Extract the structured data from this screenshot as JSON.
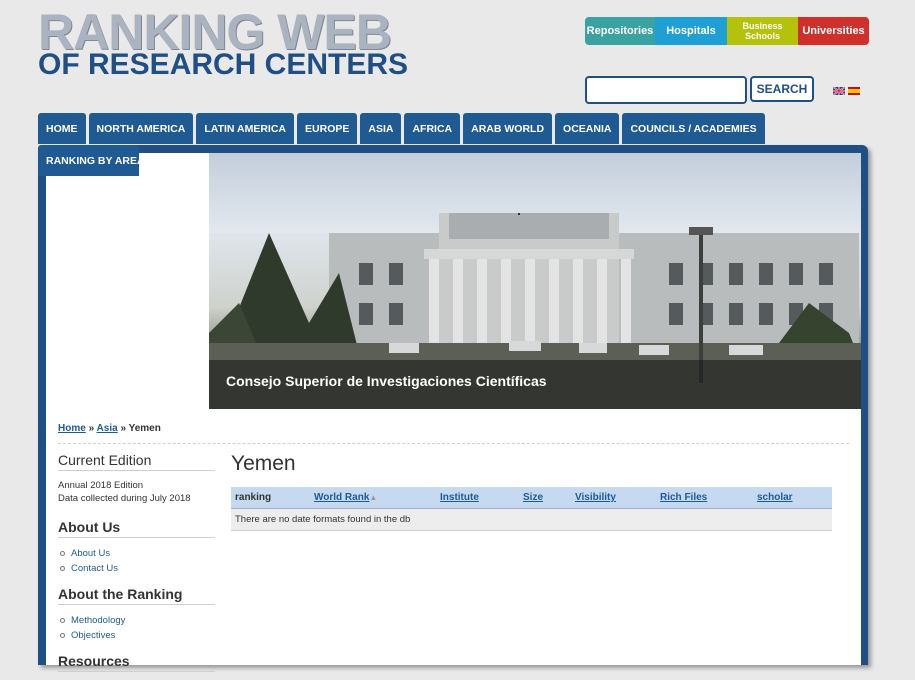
{
  "logo": {
    "line1": "RANKING WEB",
    "line2": "OF RESEARCH CENTERS"
  },
  "toplinks": {
    "repositories": "Repositories",
    "hospitals": "Hospitals",
    "business_line1": "Business",
    "business_line2": "Schools",
    "universities": "Universities"
  },
  "search": {
    "button": "SEARCH",
    "placeholder": ""
  },
  "nav": {
    "items": [
      "HOME",
      "NORTH AMERICA",
      "LATIN AMERICA",
      "EUROPE",
      "ASIA",
      "AFRICA",
      "ARAB WORLD",
      "OCEANIA",
      "COUNCILS / ACADEMIES"
    ],
    "second_row": "RANKING BY AREAS"
  },
  "hero": {
    "caption": "Consejo Superior de Investigaciones Científicas"
  },
  "breadcrumb": {
    "home": "Home",
    "sep1": " » ",
    "asia": "Asia",
    "sep2": " » ",
    "current": "Yemen"
  },
  "sidebar": {
    "current_edition": {
      "title": "Current Edition",
      "line1": "Annual 2018 Edition",
      "line2": "Data collected during July 2018"
    },
    "about_us": {
      "title": "About Us",
      "items": [
        "About Us",
        "Contact Us"
      ]
    },
    "about_ranking": {
      "title": "About the Ranking",
      "items": [
        "Methodology",
        "Objectives"
      ]
    },
    "resources": {
      "title": "Resources"
    }
  },
  "main": {
    "title": "Yemen",
    "table": {
      "headers": [
        "ranking",
        "World Rank",
        "Institute",
        "Size",
        "Visibility",
        "Rich Files",
        "scholar"
      ],
      "empty_message": "There are no date formats found in the db"
    }
  },
  "colors": {
    "brand_blue": "#1f4f85",
    "nav_blue": "#1f5a93",
    "table_header": "#c5d9f1"
  }
}
